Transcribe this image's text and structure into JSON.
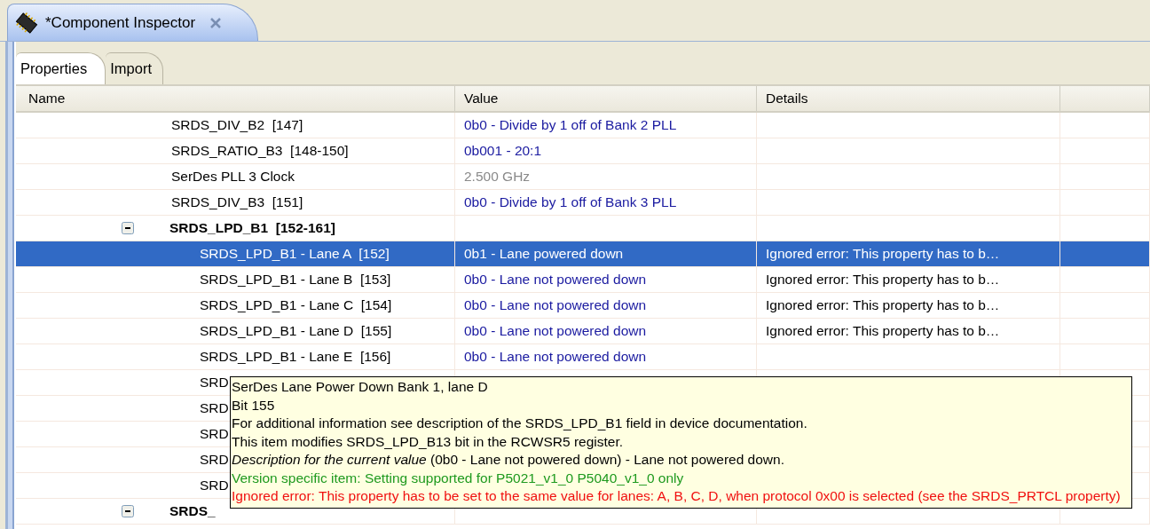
{
  "window": {
    "title": "*Component Inspector"
  },
  "tabs": [
    {
      "label": "Properties",
      "selected": true
    },
    {
      "label": "Import",
      "selected": false
    }
  ],
  "table": {
    "columns": [
      "Name",
      "Value",
      "Details"
    ],
    "rows": [
      {
        "name": "SRDS_DIV_B2  [147]",
        "value": "0b0 - Divide by 1 off of Bank 2 PLL",
        "editable": true,
        "selected": false
      },
      {
        "name": "SRDS_RATIO_B3  [148-150]",
        "value": "0b001 - 20:1",
        "editable": true,
        "selected": false
      },
      {
        "name": "SerDes PLL 3 Clock",
        "value": "2.500 GHz",
        "editable": false,
        "selected": false
      },
      {
        "name": "SRDS_DIV_B3  [151]",
        "value": "0b0 - Divide by 1 off of Bank 3 PLL",
        "editable": true,
        "selected": false
      },
      {
        "name": "SRDS_LPD_B1  [152-161]",
        "expanded": true,
        "selected": false,
        "children": [
          {
            "name": "SRDS_LPD_B1 - Lane A  [152]",
            "value": "0b1 - Lane powered down",
            "details": "Ignored error: This property has to b…",
            "editable": true,
            "selected": true
          },
          {
            "name": "SRDS_LPD_B1 - Lane B  [153]",
            "value": "0b0 - Lane not powered down",
            "details": "Ignored error: This property has to b…",
            "editable": true,
            "selected": false
          },
          {
            "name": "SRDS_LPD_B1 - Lane C  [154]",
            "value": "0b0 - Lane not powered down",
            "details": "Ignored error: This property has to b…",
            "editable": true,
            "selected": false
          },
          {
            "name": "SRDS_LPD_B1 - Lane D  [155]",
            "value": "0b0 - Lane not powered down",
            "details": "Ignored error: This property has to b…",
            "editable": true,
            "selected": false
          },
          {
            "name": "SRDS_LPD_B1 - Lane E  [156]",
            "value": "0b0 - Lane not powered down",
            "editable": true,
            "selected": false
          },
          {
            "name": "SRD",
            "selected": false
          },
          {
            "name": "SRD",
            "selected": false
          },
          {
            "name": "SRD",
            "selected": false
          },
          {
            "name": "SRD",
            "selected": false
          },
          {
            "name": "SRD",
            "selected": false
          }
        ]
      },
      {
        "name": "SRDS_",
        "expanded": true,
        "selected": false
      }
    ]
  },
  "tooltip": {
    "lines": [
      {
        "kind": "plain",
        "text": "SerDes Lane Power Down Bank 1, lane D"
      },
      {
        "kind": "plain",
        "text": "Bit 155"
      },
      {
        "kind": "plain",
        "text": "For additional information see description of the SRDS_LPD_B1 field in device documentation."
      },
      {
        "kind": "plain",
        "text": "This item modifies SRDS_LPD_B13 bit in the RCWSR5 register."
      },
      {
        "kind": "plain",
        "text": "*Description for the current value* (0b0 - Lane not powered down) - Lane not powered down."
      },
      {
        "kind": "version",
        "text": "Version specific item: Setting supported for P5021_v1_0 P5040_v1_0 only"
      },
      {
        "kind": "error",
        "text": "Ignored error: This property has to be set to the same value for lanes: A, B, C, D, when protocol 0x00 is selected (see the SRDS_PRTCL property)"
      }
    ]
  }
}
